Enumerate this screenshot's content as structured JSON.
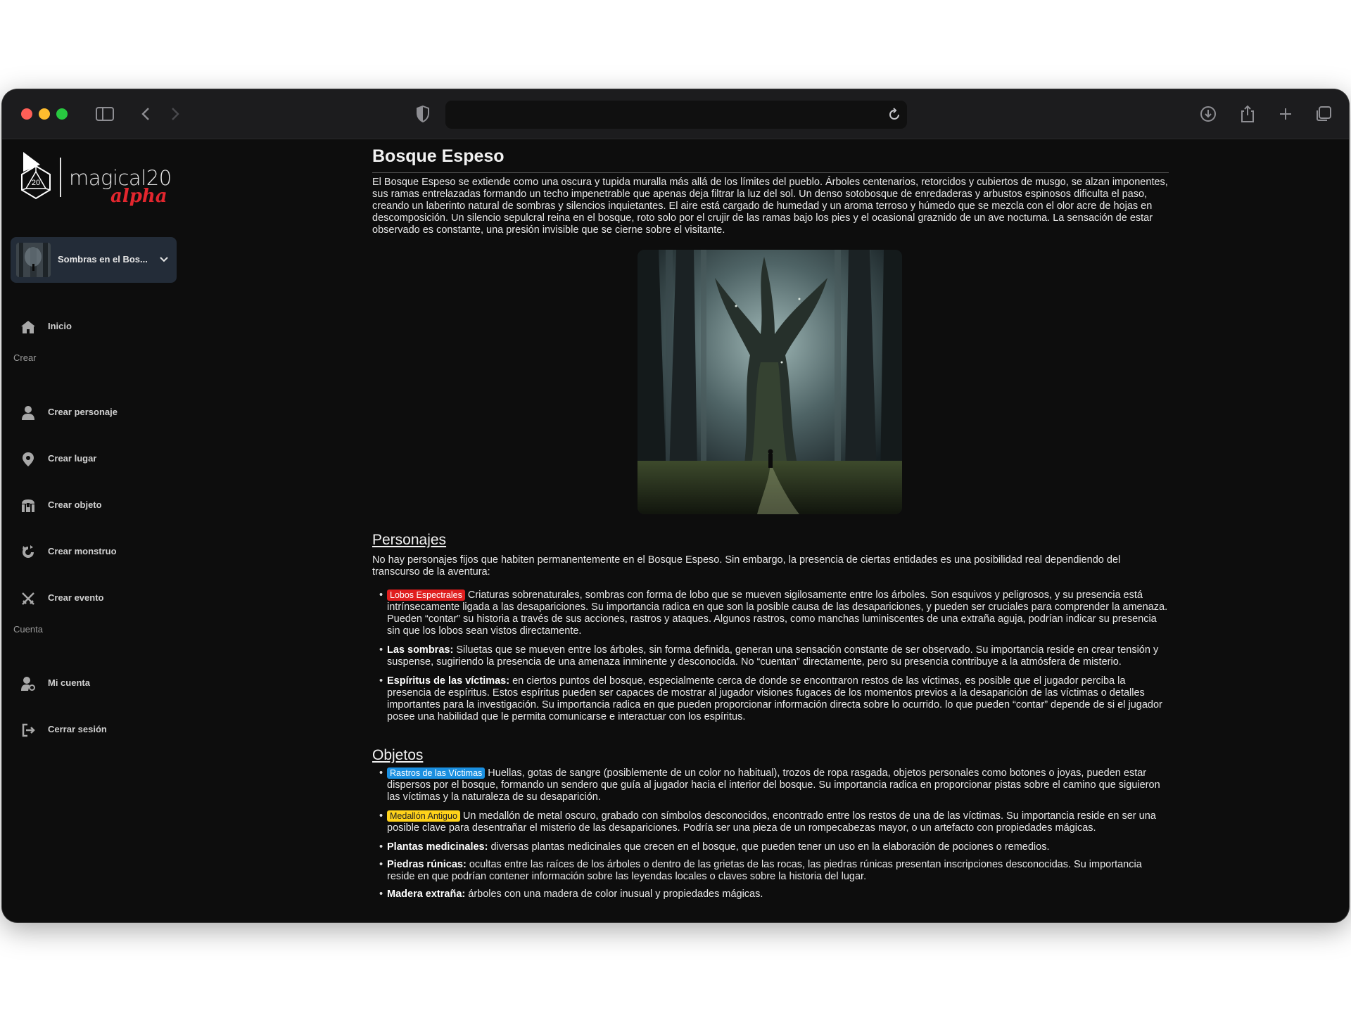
{
  "browser": {
    "address": ""
  },
  "sidebar": {
    "logo_text": "magical20",
    "logo_sub": "alpha",
    "adventure_title": "Sombras en el Bos...",
    "items": [
      {
        "label": "Inicio",
        "icon": "home-icon"
      },
      {
        "label": "Crear personaje",
        "icon": "person-icon"
      },
      {
        "label": "Crear lugar",
        "icon": "map-pin-icon"
      },
      {
        "label": "Crear objeto",
        "icon": "chest-icon"
      },
      {
        "label": "Crear monstruo",
        "icon": "monster-icon"
      },
      {
        "label": "Crear evento",
        "icon": "crossed-swords-icon"
      },
      {
        "label": "Mi cuenta",
        "icon": "user-settings-icon"
      },
      {
        "label": "Cerrar sesión",
        "icon": "logout-icon"
      }
    ],
    "sections": {
      "create": "Crear",
      "account": "Cuenta"
    }
  },
  "content": {
    "title": "Bosque Espeso",
    "intro": "El Bosque Espeso se extiende como una oscura y tupida muralla más allá de los límites del pueblo. Árboles centenarios, retorcidos y cubiertos de musgo, se alzan imponentes, sus ramas entrelazadas formando un techo impenetrable que apenas deja filtrar la luz del sol.  Un denso sotobosque de enredaderas y arbustos espinosos dificulta el paso, creando un laberinto natural de sombras y silencios inquietantes.  El aire está cargado de humedad y un aroma terroso y húmedo que se mezcla con el olor acre de hojas en descomposición.  Un silencio sepulcral reina en el bosque, roto solo por el crujir de las ramas bajo los pies y el ocasional graznido de un ave nocturna. La sensación de estar observado es constante, una presión invisible que se cierne sobre el visitante.",
    "characters": {
      "heading": "Personajes",
      "intro": "No hay personajes fijos que habiten permanentemente en el Bosque Espeso. Sin embargo, la presencia de ciertas entidades es una posibilidad real dependiendo del transcurso de la aventura:",
      "items": [
        {
          "tag": "Lobos Espectrales",
          "text": "Criaturas sobrenaturales, sombras con forma de lobo que se mueven sigilosamente entre los árboles. Son esquivos y peligrosos, y su presencia está intrínsecamente ligada a las desapariciones.  Su importancia radica en que son la posible causa de las desapariciones, y pueden ser cruciales para comprender la amenaza. Pueden “contar” su historia a través de sus acciones, rastros y ataques.  Algunos rastros, como manchas luminiscentes de una extraña aguja, podrían indicar su presencia sin que los lobos sean vistos directamente."
        },
        {
          "bold": "Las sombras:",
          "text": "Siluetas que se mueven entre los árboles, sin forma definida, generan una sensación constante de ser observado.  Su importancia reside en crear tensión y suspense, sugiriendo la presencia de una amenaza inminente y desconocida. No “cuentan” directamente, pero su presencia contribuye a la atmósfera de misterio."
        },
        {
          "bold": "Espíritus de las víctimas:",
          "text": "en ciertos puntos del bosque, especialmente cerca de donde se encontraron restos de las víctimas, es posible que el jugador perciba la presencia de espíritus. Estos espíritus pueden ser capaces de mostrar al jugador visiones fugaces de los momentos previos a la desaparición de las víctimas o detalles importantes para la investigación. Su importancia radica en que pueden proporcionar información directa sobre lo ocurrido. lo que pueden “contar” depende de si el jugador posee una habilidad que le permita comunicarse e interactuar con los espíritus."
        }
      ]
    },
    "objects": {
      "heading": "Objetos",
      "items": [
        {
          "tag": "Rastros de las Víctimas",
          "text": "Huellas, gotas de sangre (posiblemente de un color no habitual), trozos de ropa rasgada, objetos personales como botones o joyas, pueden estar dispersos por el bosque, formando un sendero que guía al jugador hacia el interior del bosque.  Su importancia radica en proporcionar pistas sobre el camino que siguieron las víctimas y la naturaleza de su desaparición."
        },
        {
          "tag": "Medallón Antiguo",
          "text": "Un medallón de metal oscuro, grabado con símbolos desconocidos, encontrado entre los restos de una de las víctimas. Su importancia reside en ser una posible clave para desentrañar el misterio de las desapariciones.  Podría ser una pieza de un rompecabezas mayor, o un artefacto con propiedades mágicas."
        },
        {
          "bold": "Plantas medicinales:",
          "text": "diversas plantas medicinales que crecen en el bosque, que pueden tener un uso en la elaboración de pociones o remedios."
        },
        {
          "bold": "Piedras rúnicas:",
          "text": " ocultas entre las raíces de los árboles o dentro de las grietas de las rocas, las piedras rúnicas presentan inscripciones desconocidas. Su importancia reside en que podrían contener información sobre las leyendas locales o claves sobre la historia del lugar."
        },
        {
          "bold": "Madera extraña:",
          "text": "árboles con una madera de color inusual y propiedades mágicas."
        }
      ]
    }
  },
  "colors": {
    "accent_red": "#e01e1e",
    "accent_blue": "#1a8fe0",
    "accent_yellow": "#ffd21a",
    "logo_alpha": "#e3262e"
  }
}
